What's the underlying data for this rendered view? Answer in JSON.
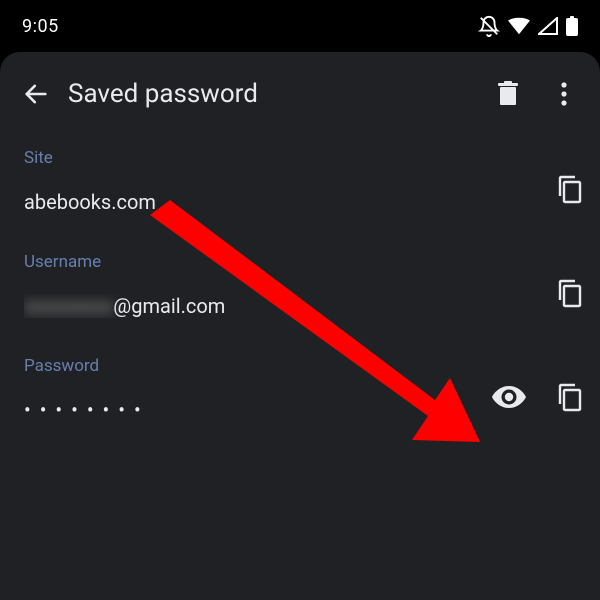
{
  "status": {
    "time": "9:05"
  },
  "appbar": {
    "title": "Saved password"
  },
  "fields": {
    "site": {
      "label": "Site",
      "value": "abebooks.com"
    },
    "username": {
      "label": "Username",
      "suffix": "@gmail.com"
    },
    "password": {
      "label": "Password",
      "value": "• • • • • • • •"
    }
  }
}
